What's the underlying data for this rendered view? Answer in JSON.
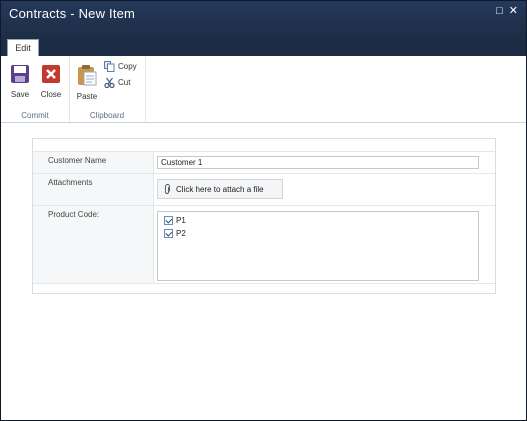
{
  "window": {
    "title": "Contracts - New Item",
    "controls": [
      "restore-icon",
      "close-icon"
    ]
  },
  "ribbon": {
    "tabs": [
      {
        "label": "Edit",
        "active": true
      }
    ],
    "groups": {
      "commit": {
        "label": "Commit",
        "save": {
          "label": "Save",
          "icon": "save-icon"
        },
        "close": {
          "label": "Close",
          "icon": "close-icon"
        }
      },
      "clipboard": {
        "label": "Clipboard",
        "paste": {
          "label": "Paste",
          "icon": "paste-icon"
        },
        "copy": {
          "label": "Copy",
          "icon": "copy-icon"
        },
        "cut": {
          "label": "Cut",
          "icon": "cut-icon"
        }
      }
    }
  },
  "form": {
    "customer_name": {
      "label": "Customer Name",
      "value": "Customer 1"
    },
    "attachments": {
      "label": "Attachments",
      "button": "Click here to attach a file",
      "icon": "paperclip-icon"
    },
    "product_code": {
      "label": "Product Code:",
      "options": [
        {
          "label": "P1",
          "checked": true
        },
        {
          "label": "P2",
          "checked": true
        }
      ]
    }
  },
  "colors": {
    "titlebar": "#1c2c44",
    "accent": "#1b4b82",
    "label_bg": "#f6f7f8"
  }
}
